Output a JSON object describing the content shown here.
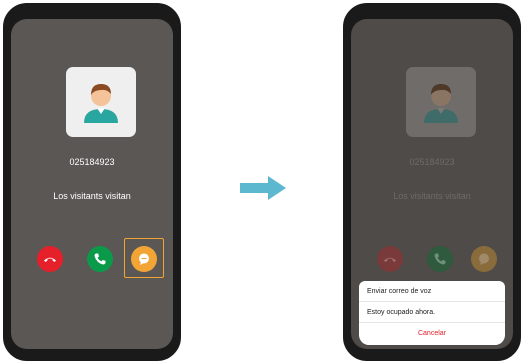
{
  "incoming_call": {
    "number": "025184923",
    "name": "Los visitants visitan"
  },
  "after_message": {
    "number": "025184923",
    "name": "Los visitants visitan",
    "sheet": {
      "options": [
        "Enviar correo de voz",
        "Estoy ocupado ahora."
      ],
      "cancel": "Cancelar"
    }
  },
  "colors": {
    "decline": "#e5202a",
    "accept": "#0a9a4a",
    "message": "#f2a435",
    "arrow": "#5bb8cf",
    "cancel_text": "#e5202a"
  },
  "icons": [
    "avatar-icon",
    "hang-up-icon",
    "phone-icon",
    "message-icon",
    "arrow-right-icon"
  ]
}
